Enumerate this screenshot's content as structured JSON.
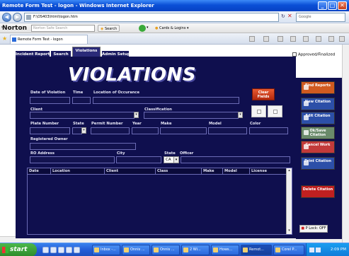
{
  "window": {
    "title": "Remote Form Test - logon - Windows Internet Explorer",
    "min": "_",
    "max": "□",
    "close": "✕"
  },
  "address": {
    "url": "F:\\OS403\\html\\logon.htm",
    "search_placeholder": "Google"
  },
  "norton": {
    "logo": "Norton",
    "search_placeholder": "Norton Safe Search",
    "search_button": "Search",
    "cards_logins": "Cards & Logins"
  },
  "tab": {
    "label": "Remote Form Test - logon"
  },
  "app": {
    "tabs": [
      "Incident Report",
      "Search",
      "Violations",
      "Admin Setup"
    ],
    "approved_label": "Approved/Finalized",
    "title": "VIOLATIONS",
    "labels": {
      "date": "Date of Violation",
      "time": "Time",
      "location": "Location of Occurance",
      "client": "Client",
      "classification": "Classification",
      "plate": "Plate Number",
      "state": "State",
      "permit": "Permit Number",
      "year": "Year",
      "make": "Make",
      "model": "Model",
      "color": "Color",
      "registered_owner": "Registered Owner",
      "ro_address": "RO Address",
      "city": "City",
      "state2": "State",
      "officer": "Officer"
    },
    "state_value": "CA",
    "clear_fields": "Clear Fields",
    "grid_columns": [
      "Date",
      "Location",
      "Client",
      "Class",
      "Make",
      "Model",
      "License"
    ]
  },
  "actions": [
    {
      "label": "Find Reports",
      "color": "#d05a20"
    },
    {
      "label": "New Citation",
      "color": "#2c4fa8"
    },
    {
      "label": "Edit Citation",
      "color": "#2c4fa8"
    },
    {
      "label": "Ok/Save Citation",
      "color": "#6a8a6a"
    },
    {
      "label": "Cancel Work",
      "color": "#c23a3a"
    },
    {
      "label": "Print Citation",
      "color": "#2c4fa8"
    },
    {
      "label": "Delete Citation",
      "color": "#c02020"
    }
  ],
  "plock": "P Lock: OFF",
  "taskbar": {
    "start": "start",
    "tasks": [
      "Inbox -...",
      "Onnis ...",
      "Onnis ...",
      "2 Wi...",
      "Hows...",
      "Remot...",
      "Corel P..."
    ],
    "clock": "2:09 PM"
  }
}
